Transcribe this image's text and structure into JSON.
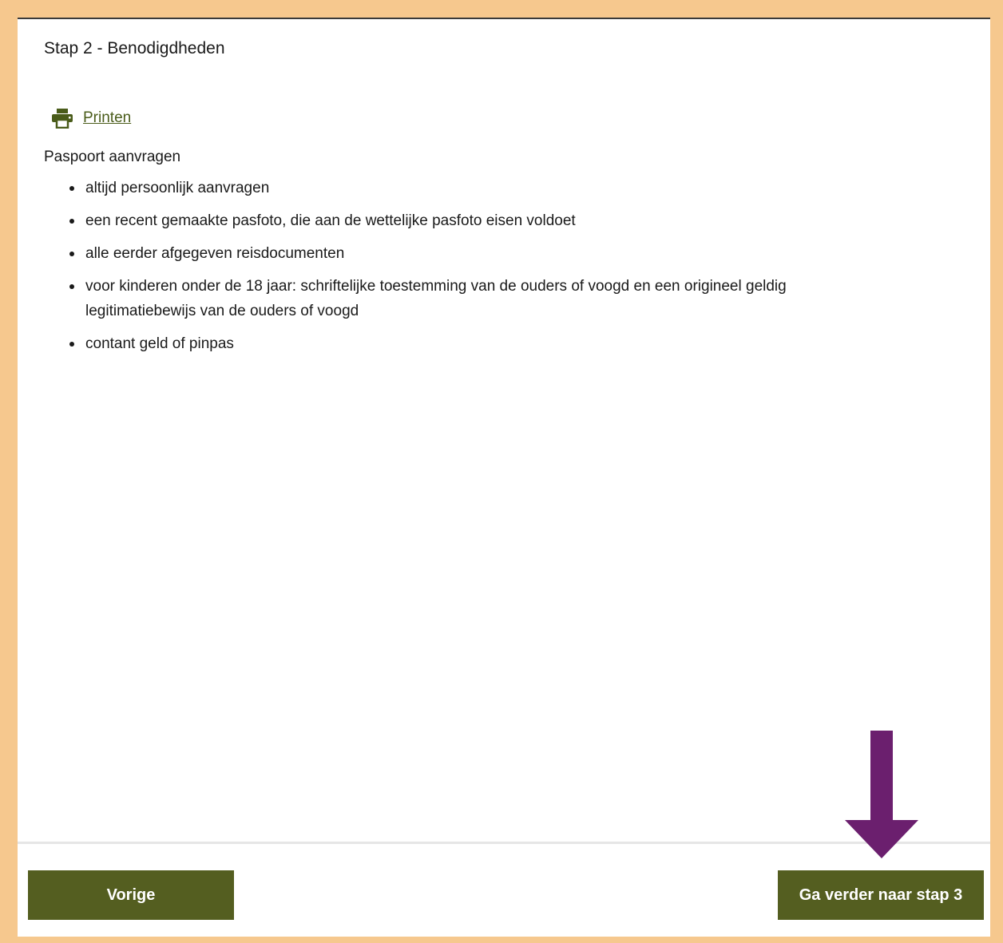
{
  "step": {
    "title": "Stap 2 - Benodigdheden"
  },
  "print": {
    "label": "Printen",
    "icon": "printer-icon"
  },
  "content": {
    "intro": "Paspoort aanvragen",
    "items": [
      "altijd persoonlijk aanvragen",
      "een recent gemaakte pasfoto, die aan de wettelijke pasfoto eisen voldoet",
      "alle eerder afgegeven reisdocumenten",
      "voor kinderen onder de 18 jaar: schriftelijke toestemming van de ouders of voogd en een origineel geldig legitimatiebewijs van de ouders of voogd",
      "contant geld of pinpas"
    ]
  },
  "navigation": {
    "prev_label": "Vorige",
    "next_label": "Ga verder naar stap 3"
  },
  "annotation": {
    "icon": "arrow-down-icon",
    "color": "#6b1f6e"
  },
  "colors": {
    "page_border": "#f6c88e",
    "button": "#545e20",
    "link": "#4a5c1a"
  }
}
